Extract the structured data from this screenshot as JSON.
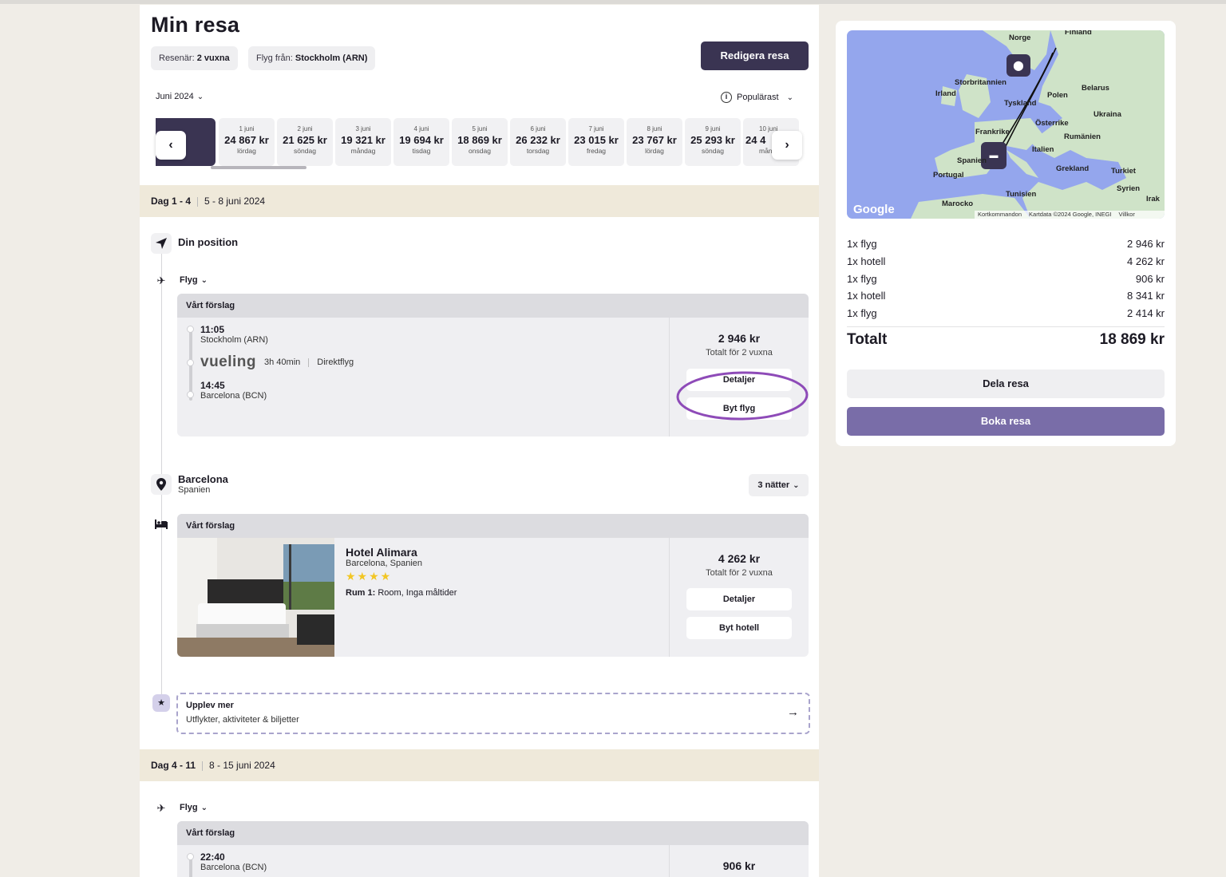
{
  "page": {
    "title": "Min resa",
    "travelers_label": "Resenär:",
    "travelers_value": "2 vuxna",
    "from_label": "Flyg från:",
    "from_value": "Stockholm (ARN)",
    "edit_button": "Redigera resa",
    "month": "Juni 2024",
    "sort": "Populärast"
  },
  "dates": [
    {
      "d": "1 juni",
      "p": "24 867 kr",
      "w": "lördag"
    },
    {
      "d": "2 juni",
      "p": "21 625 kr",
      "w": "söndag"
    },
    {
      "d": "3 juni",
      "p": "19 321 kr",
      "w": "måndag"
    },
    {
      "d": "4 juni",
      "p": "19 694 kr",
      "w": "tisdag"
    },
    {
      "d": "5 juni",
      "p": "18 869 kr",
      "w": "onsdag"
    },
    {
      "d": "6 juni",
      "p": "26 232 kr",
      "w": "torsdag"
    },
    {
      "d": "7 juni",
      "p": "23 015 kr",
      "w": "fredag"
    },
    {
      "d": "8 juni",
      "p": "23 767 kr",
      "w": "lördag"
    },
    {
      "d": "9 juni",
      "p": "25 293 kr",
      "w": "söndag"
    },
    {
      "d": "10 juni",
      "p": "24 4",
      "w": "mån"
    }
  ],
  "day1": {
    "label": "Dag 1 - 4",
    "range": "5 - 8 juni 2024"
  },
  "day2": {
    "label": "Dag 4 - 11",
    "range": "8 - 15 juni 2024"
  },
  "position_label": "Din position",
  "flight_label": "Flyg",
  "suggestion_label": "Vårt förslag",
  "flight1": {
    "dep_time": "11:05",
    "dep_place": "Stockholm (ARN)",
    "airline": "vueling",
    "duration": "3h 40min",
    "type": "Direktflyg",
    "arr_time": "14:45",
    "arr_place": "Barcelona (BCN)",
    "price": "2 946 kr",
    "price_sub": "Totalt för 2 vuxna",
    "details_button": "Detaljer",
    "change_button": "Byt flyg"
  },
  "destination": {
    "city": "Barcelona",
    "country": "Spanien",
    "nights": "3 nätter"
  },
  "hotel": {
    "name": "Hotel Alimara",
    "location": "Barcelona, Spanien",
    "stars": 4,
    "room_label": "Rum 1:",
    "room_value": "Room, Inga måltider",
    "price": "4 262 kr",
    "price_sub": "Totalt för 2 vuxna",
    "details_button": "Detaljer",
    "change_button": "Byt hotell"
  },
  "experience": {
    "title": "Upplev mer",
    "subtitle": "Utflykter, aktiviteter & biljetter"
  },
  "flight2": {
    "dep_time": "22:40",
    "dep_place": "Barcelona (BCN)",
    "price": "906 kr"
  },
  "map": {
    "labels": [
      "Finland",
      "Norge",
      "Storbritannien",
      "Irland",
      "Belarus",
      "Tyskland",
      "Polen",
      "Ukraina",
      "Österrike",
      "Frankrike",
      "Rumänien",
      "Italien",
      "Spanien",
      "Portugal",
      "Grekland",
      "Turkiet",
      "Tunisien",
      "Syrien",
      "Marocko",
      "Irak"
    ],
    "attribution": [
      "Google",
      "Kortkommandon",
      "Kartdata ©2024 Google, INEGI",
      "Villkor"
    ],
    "colors": {
      "water": "#94a6ed",
      "land": "#cfe3c8"
    }
  },
  "summary": {
    "items": [
      {
        "label": "1x flyg",
        "value": "2 946 kr"
      },
      {
        "label": "1x hotell",
        "value": "4 262 kr"
      },
      {
        "label": "1x flyg",
        "value": "906 kr"
      },
      {
        "label": "1x hotell",
        "value": "8 341 kr"
      },
      {
        "label": "1x flyg",
        "value": "2 414 kr"
      }
    ],
    "total_label": "Totalt",
    "total_value": "18 869 kr",
    "share_button": "Dela resa",
    "book_button": "Boka resa"
  },
  "colors": {
    "primary_dark": "#3a3452",
    "book_purple": "#796da8",
    "day_bar": "#efe9da",
    "highlight_circle": "#8e4bb8",
    "star": "#f2c624"
  }
}
